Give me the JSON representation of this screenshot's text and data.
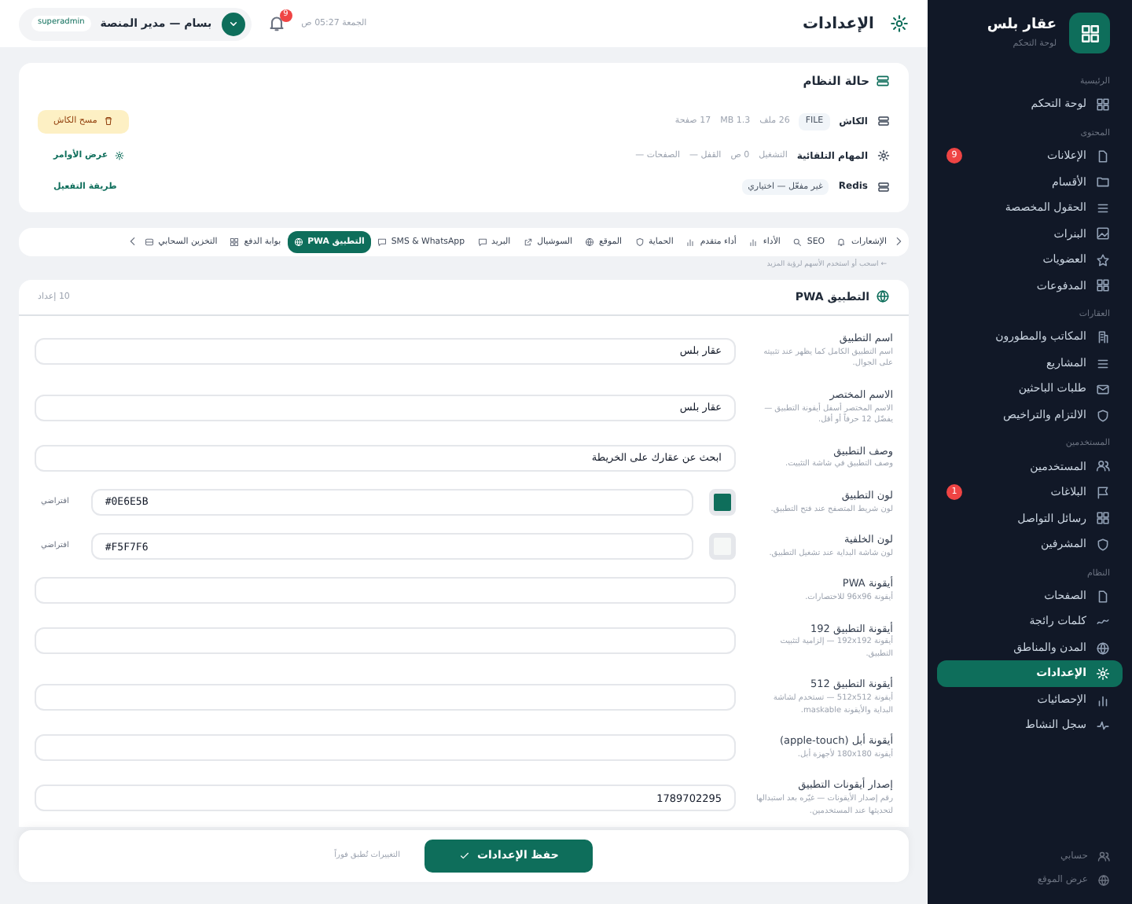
{
  "header": {
    "title": "الإعدادات",
    "datetime": "الجمعة 05:27 ص",
    "notifications": "9",
    "user": {
      "name": "بسام — مدير المنصة",
      "role": "superadmin"
    }
  },
  "system_status": {
    "title": "حالة النظام",
    "rows": [
      {
        "label": "الكاش",
        "tags": [
          "FILE"
        ],
        "details": [
          "26 ملف",
          "1.3 MB",
          "17 صفحة"
        ],
        "action": "مسح الكاش",
        "kind": "warning"
      },
      {
        "label": "المهام التلقائية",
        "tags": [],
        "details": [
          "التشغيل",
          "0 ص",
          "القفل —",
          "الصفحات —"
        ],
        "action": "عرض الأوامر",
        "kind": "link"
      },
      {
        "label": "Redis",
        "tags": [
          "غير مفعّل — اختياري"
        ],
        "details": [],
        "action": "طريقة التفعيل",
        "kind": "link"
      }
    ]
  },
  "tabs": [
    {
      "label": "الإشعارات",
      "selected": false
    },
    {
      "label": "SEO",
      "selected": false
    },
    {
      "label": "الأداء",
      "selected": false
    },
    {
      "label": "أداء متقدم",
      "selected": false
    },
    {
      "label": "الحماية",
      "selected": false
    },
    {
      "label": "الموقع",
      "selected": false
    },
    {
      "label": "السوشيال",
      "selected": false
    },
    {
      "label": "البريد",
      "selected": false
    },
    {
      "label": "SMS & WhatsApp",
      "selected": false
    },
    {
      "label": "التطبيق PWA",
      "selected": true
    },
    {
      "label": "بوابة الدفع",
      "selected": false
    },
    {
      "label": "التخزين السحابي",
      "selected": false
    }
  ],
  "tabs_hint": "← اسحب أو استخدم الأسهم لرؤية المزيد",
  "section": {
    "title": "التطبيق PWA",
    "count": "10 إعداد",
    "fields": [
      {
        "kind": "text",
        "label": "اسم التطبيق",
        "hint": "اسم التطبيق الكامل كما يظهر عند تثبيته على الجوال.",
        "value": "عقار بلس"
      },
      {
        "kind": "text",
        "label": "الاسم المختصر",
        "hint": "الاسم المختصر أسفل أيقونة التطبيق — يفضّل 12 حرفاً أو أقل.",
        "value": "عقار بلس"
      },
      {
        "kind": "text",
        "label": "وصف التطبيق",
        "hint": "وصف التطبيق في شاشة التثبيت.",
        "value": "ابحث عن عقارك على الخريطة"
      },
      {
        "kind": "color",
        "label": "لون التطبيق",
        "hint": "لون شريط المتصفح عند فتح التطبيق.",
        "value": "#0E6E5B",
        "reset": "افتراضي"
      },
      {
        "kind": "color",
        "label": "لون الخلفية",
        "hint": "لون شاشة البداية عند تشغيل التطبيق.",
        "value": "#F5F7F6",
        "reset": "افتراضي"
      },
      {
        "kind": "text",
        "label": "أيقونة PWA",
        "hint": "أيقونة 96x96 للاختصارات."
      },
      {
        "kind": "text",
        "label": "أيقونة التطبيق 192",
        "hint": "أيقونة 192x192 — إلزامية لتثبيت التطبيق."
      },
      {
        "kind": "text",
        "label": "أيقونة التطبيق 512",
        "hint": "أيقونة 512x512 — تستخدم لشاشة البداية والأيقونة maskable."
      },
      {
        "kind": "text",
        "label": "أيقونة أبل (apple-touch)",
        "hint": "أيقونة 180x180 لأجهزة أبل."
      },
      {
        "kind": "text",
        "label": "إصدار أيقونات التطبيق",
        "hint": "رقم إصدار الأيقونات — غيّره بعد استبدالها لتحديثها عند المستخدمين.",
        "value": "1789702295"
      }
    ]
  },
  "footer": {
    "save": "حفظ الإعدادات",
    "note": "التغييرات تُطبق فوراً"
  },
  "sidebar": {
    "brand": "عقار بلس",
    "subtitle": "لوحة التحكم",
    "sections": [
      {
        "title": "الرئيسية",
        "items": [
          {
            "label": "لوحة التحكم",
            "selected": false
          }
        ]
      },
      {
        "title": "المحتوى",
        "items": [
          {
            "label": "الإعلانات",
            "selected": false,
            "badge": "9"
          },
          {
            "label": "الأقسام",
            "selected": false
          },
          {
            "label": "الحقول المخصصة",
            "selected": false
          },
          {
            "label": "البنرات",
            "selected": false
          },
          {
            "label": "العضويات",
            "selected": false
          },
          {
            "label": "المدفوعات",
            "selected": false
          }
        ]
      },
      {
        "title": "العقارات",
        "items": [
          {
            "label": "المكاتب والمطورون",
            "selected": false
          },
          {
            "label": "المشاريع",
            "selected": false
          },
          {
            "label": "طلبات الباحثين",
            "selected": false
          },
          {
            "label": "الالتزام والتراخيص",
            "selected": false
          }
        ]
      },
      {
        "title": "المستخدمين",
        "items": [
          {
            "label": "المستخدمين",
            "selected": false
          },
          {
            "label": "البلاغات",
            "selected": false,
            "badge": "1"
          },
          {
            "label": "رسائل التواصل",
            "selected": false
          },
          {
            "label": "المشرفين",
            "selected": false
          }
        ]
      },
      {
        "title": "النظام",
        "items": [
          {
            "label": "الصفحات",
            "selected": false
          },
          {
            "label": "كلمات رائجة",
            "selected": false
          },
          {
            "label": "المدن والمناطق",
            "selected": false
          },
          {
            "label": "الإعدادات",
            "selected": true
          },
          {
            "label": "الإحصائيات",
            "selected": false
          },
          {
            "label": "سجل النشاط",
            "selected": false
          }
        ]
      }
    ],
    "bottom": [
      {
        "label": "حسابي"
      },
      {
        "label": "عرض الموقع"
      }
    ]
  }
}
